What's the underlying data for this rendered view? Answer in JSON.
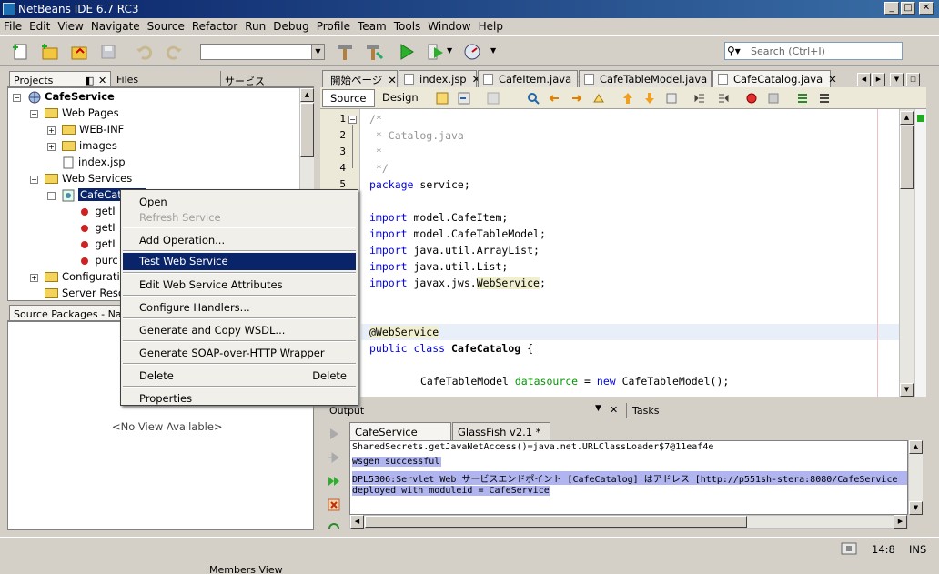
{
  "window": {
    "title": "NetBeans IDE 6.7 RC3"
  },
  "menu": [
    "File",
    "Edit",
    "View",
    "Navigate",
    "Source",
    "Refactor",
    "Run",
    "Debug",
    "Profile",
    "Team",
    "Tools",
    "Window",
    "Help"
  ],
  "search": {
    "placeholder": "Search (Ctrl+I)"
  },
  "left_tabs": {
    "projects": "Projects",
    "files": "Files",
    "services": "サービス"
  },
  "tree": {
    "root": "CafeService",
    "web_pages": "Web Pages",
    "web_inf": "WEB-INF",
    "images": "images",
    "index": "index.jsp",
    "web_services": "Web Services",
    "service": "CafeCatalog",
    "ops": [
      "getI",
      "getI",
      "getI",
      "purc"
    ],
    "config": "Configuration",
    "server": "Server Reso"
  },
  "navigator": {
    "title": "Source Packages - Navi",
    "empty": "<No View Available>",
    "members_view": "Members View"
  },
  "editor_tabs": [
    "開始ページ",
    "index.jsp",
    "CafeItem.java",
    "CafeTableModel.java",
    "CafeCatalog.java"
  ],
  "editor_toolbar": {
    "source": "Source",
    "design": "Design"
  },
  "code": {
    "numbers": [
      "1",
      "2",
      "3",
      "4",
      "5"
    ],
    "l1": "/*",
    "l2": " * Catalog.java",
    "l3": " *",
    "l4": " */",
    "l5a": "package",
    "l5b": " service;",
    "i1a": "import",
    "i1b": " model.CafeItem;",
    "i2a": "import",
    "i2b": " model.CafeTableModel;",
    "i3a": "import",
    "i3b": " java.util.ArrayList;",
    "i4a": "import",
    "i4b": " java.util.List;",
    "i5a": "import",
    "i5b": " javax.jws.",
    "i5c": "WebService",
    "i5d": ";",
    "ann": "@WebService",
    "cls_a": "public class ",
    "cls_b": "CafeCatalog",
    "cls_c": " {",
    "field_a": "CafeTableModel ",
    "field_b": "datasource",
    "field_c": " = ",
    "field_d": "new",
    "field_e": " CafeTableModel();"
  },
  "output": {
    "title": "Output",
    "tasks": "Tasks",
    "tabs": [
      "CafeService (run)",
      "GlassFish v2.1 *"
    ],
    "lines": [
      "SharedSecrets.getJavaNetAccess()=java.net.URLClassLoader$7@11eaf4e",
      "wsgen successful",
      "DPL5306:Servlet Web サービスエンドポイント [CafeCatalog] はアドレス [http://p551sh-stera:8080/CafeService",
      "deployed with moduleid = CafeService"
    ]
  },
  "context_menu": {
    "items": [
      "Open",
      "Refresh Service",
      "Add Operation...",
      "Test Web Service",
      "Edit Web Service Attributes",
      "Configure Handlers...",
      "Generate and Copy WSDL...",
      "Generate SOAP-over-HTTP Wrapper",
      "Delete",
      "Properties"
    ],
    "delete_shortcut": "Delete"
  },
  "status": {
    "position": "14:8",
    "mode": "INS"
  }
}
